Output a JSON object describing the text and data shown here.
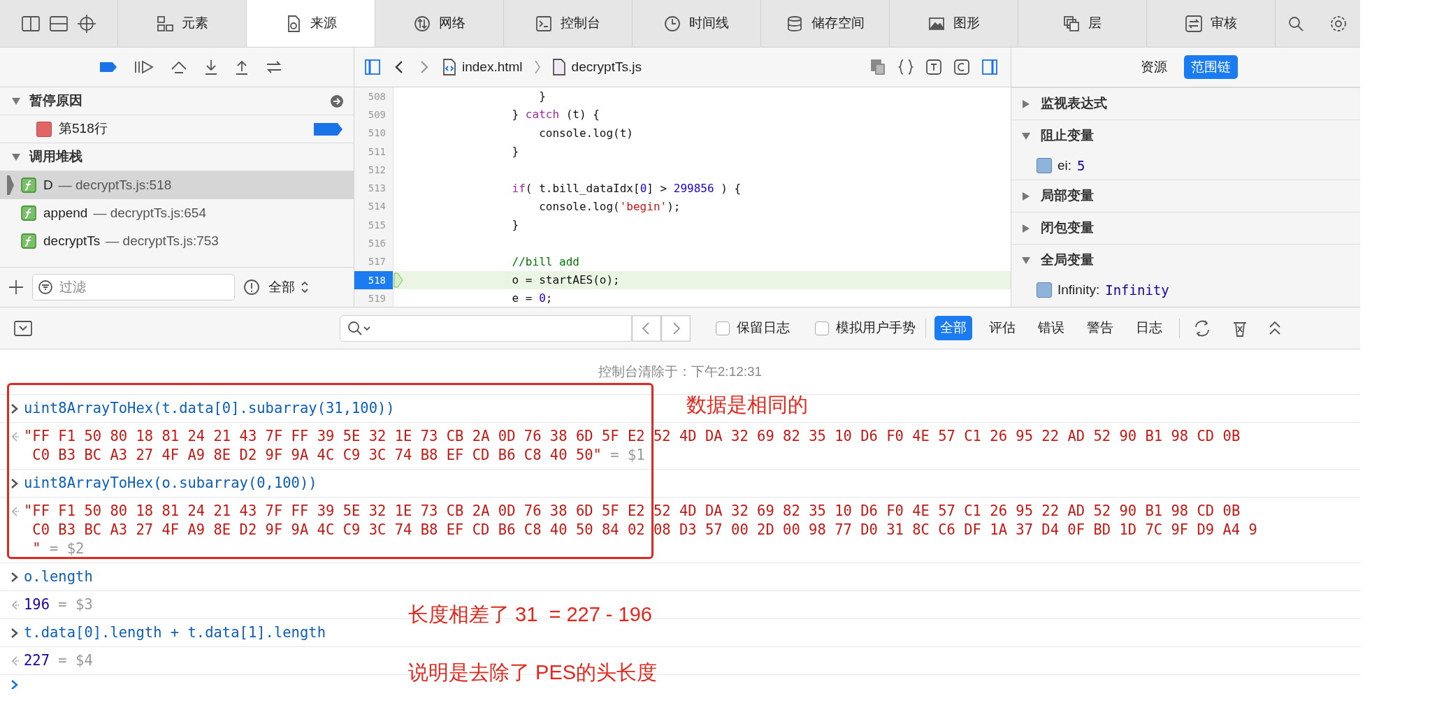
{
  "toolbar_tabs": [
    {
      "label": "元素",
      "selected": false
    },
    {
      "label": "来源",
      "selected": true
    },
    {
      "label": "网络",
      "selected": false
    },
    {
      "label": "控制台",
      "selected": false
    },
    {
      "label": "时间线",
      "selected": false
    },
    {
      "label": "储存空间",
      "selected": false
    },
    {
      "label": "图形",
      "selected": false
    },
    {
      "label": "层",
      "selected": false
    },
    {
      "label": "审核",
      "selected": false
    }
  ],
  "breadcrumbs": [
    {
      "label": "index.html",
      "kind": "html"
    },
    {
      "label": "decryptTs.js",
      "kind": "js"
    }
  ],
  "sidebar_tabs": [
    {
      "label": "资源",
      "selected": false
    },
    {
      "label": "范围链",
      "selected": true
    }
  ],
  "pause_reason": {
    "title": "暂停原因",
    "expanded": true,
    "item": "第518行"
  },
  "call_stack": {
    "title": "调用堆栈",
    "expanded": true,
    "frames": [
      {
        "name": "D",
        "location": "— decryptTs.js:518",
        "selected": true
      },
      {
        "name": "append",
        "location": "— decryptTs.js:654",
        "selected": false
      },
      {
        "name": "decryptTs",
        "location": "— decryptTs.js:753",
        "selected": false
      }
    ]
  },
  "filter": {
    "placeholder": "过滤",
    "scope": "全部"
  },
  "code_lines": [
    {
      "number": "508",
      "current": false,
      "tokens": [
        {
          "text": "                }",
          "kind": "plain"
        }
      ]
    },
    {
      "number": "509",
      "current": false,
      "tokens": [
        {
          "text": "            } ",
          "kind": "plain"
        },
        {
          "text": "catch",
          "kind": "keyword"
        },
        {
          "text": " (t) {",
          "kind": "plain"
        }
      ]
    },
    {
      "number": "510",
      "current": false,
      "tokens": [
        {
          "text": "                console.log(t)",
          "kind": "plain"
        }
      ]
    },
    {
      "number": "511",
      "current": false,
      "tokens": [
        {
          "text": "            }",
          "kind": "plain"
        }
      ]
    },
    {
      "number": "512",
      "current": false
    },
    {
      "number": "513",
      "current": false,
      "tokens": [
        {
          "text": "            if",
          "kind": "keyword"
        },
        {
          "text": "( t.bill_dataIdx[",
          "kind": "plain"
        },
        {
          "text": "0",
          "kind": "number"
        },
        {
          "text": "] > ",
          "kind": "plain"
        },
        {
          "text": "299856",
          "kind": "number"
        },
        {
          "text": " ) {",
          "kind": "plain"
        }
      ]
    },
    {
      "number": "514",
      "current": false,
      "tokens": [
        {
          "text": "                console.log(",
          "kind": "plain"
        },
        {
          "text": "'begin'",
          "kind": "string"
        },
        {
          "text": ");",
          "kind": "plain"
        }
      ]
    },
    {
      "number": "515",
      "current": false,
      "tokens": [
        {
          "text": "            }",
          "kind": "plain"
        }
      ]
    },
    {
      "number": "516",
      "current": false
    },
    {
      "number": "517",
      "current": false,
      "tokens": [
        {
          "text": "            //bill add",
          "kind": "comment"
        }
      ]
    },
    {
      "number": "518",
      "current": true,
      "tokens": [
        {
          "text": "            o = startAES(o);",
          "kind": "plain"
        }
      ]
    },
    {
      "number": "519",
      "current": false,
      "tokens": [
        {
          "text": "            e = ",
          "kind": "plain"
        },
        {
          "text": "0",
          "kind": "number"
        },
        {
          "text": ";",
          "kind": "plain"
        }
      ]
    }
  ],
  "scope_sections": [
    {
      "title": "监视表达式",
      "expanded": false
    },
    {
      "title": "阻止变量",
      "expanded": true,
      "variables": [
        {
          "name": "ei:",
          "value": "5"
        }
      ]
    },
    {
      "title": "局部变量",
      "expanded": false
    },
    {
      "title": "闭包变量",
      "expanded": false
    },
    {
      "title": "全局变量",
      "expanded": true,
      "variables": [
        {
          "name": "Infinity:",
          "value": "Infinity"
        }
      ]
    }
  ],
  "console_toolbar": {
    "checkboxes": [
      {
        "label": "保留日志",
        "checked": false
      },
      {
        "label": "模拟用户手势",
        "checked": false
      }
    ],
    "filters": [
      {
        "label": "全部",
        "selected": true
      },
      {
        "label": "评估",
        "selected": false
      },
      {
        "label": "错误",
        "selected": false
      },
      {
        "label": "警告",
        "selected": false
      },
      {
        "label": "日志",
        "selected": false
      }
    ]
  },
  "cleared_message": "控制台清除于：下午2:12:31",
  "entries": [
    {
      "kind": "input",
      "lines": [
        "uint8ArrayToHex(t.data[0].subarray(31,100))"
      ]
    },
    {
      "kind": "string",
      "lines": [
        "\"FF F1 50 80 18 81 24 21 43 7F FF 39 5E 32 1E 73 CB 2A 0D 76 38 6D 5F E2 52 4D DA 32 69 82 35 10 D6 F0 4E 57 C1 26 95 22 AD 52 90 B1 98 CD 0B",
        "C0 B3 BC A3 27 4F A9 8E D2 9F 9A 4C C9 3C 74 B8 EF CD B6 C8 40 50\""
      ],
      "ref": "= $1"
    },
    {
      "kind": "input",
      "lines": [
        "uint8ArrayToHex(o.subarray(0,100))"
      ]
    },
    {
      "kind": "string",
      "lines": [
        "\"FF F1 50 80 18 81 24 21 43 7F FF 39 5E 32 1E 73 CB 2A 0D 76 38 6D 5F E2 52 4D DA 32 69 82 35 10 D6 F0 4E 57 C1 26 95 22 AD 52 90 B1 98 CD 0B",
        "C0 B3 BC A3 27 4F A9 8E D2 9F 9A 4C C9 3C 74 B8 EF CD B6 C8 40 50 84 02 08 D3 57 00 2D 00 98 77 D0 31 8C C6 DF 1A 37 D4 0F BD 1D 7C 9F D9 A4 9",
        "\""
      ],
      "ref": "= $2"
    },
    {
      "kind": "input",
      "lines": [
        "o.length"
      ]
    },
    {
      "kind": "number",
      "lines": [
        "196"
      ],
      "ref": "= $3"
    },
    {
      "kind": "input",
      "lines": [
        "t.data[0].length + t.data[1].length"
      ]
    },
    {
      "kind": "number",
      "lines": [
        "227"
      ],
      "ref": "= $4"
    }
  ],
  "annotations": [
    "数据是相同的",
    "长度相差了 31  = 227 - 196",
    "说明是去除了 PES的头长度"
  ]
}
